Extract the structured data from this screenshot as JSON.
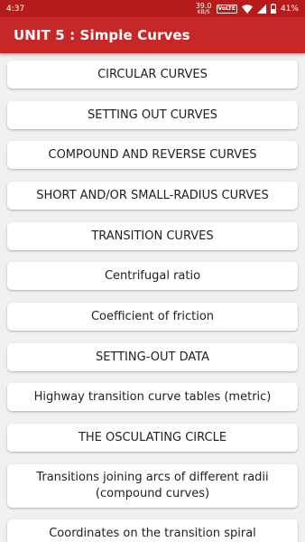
{
  "status_bar": {
    "time": "4:37",
    "net_speed": "39.0",
    "net_unit": "KB/S",
    "volte": "VoLTE",
    "battery": "41%"
  },
  "app_bar": {
    "title": "UNIT 5 : Simple Curves"
  },
  "topics": [
    "CIRCULAR CURVES",
    "SETTING OUT CURVES",
    "COMPOUND AND REVERSE CURVES",
    "SHORT AND/OR SMALL-RADIUS CURVES",
    "TRANSITION CURVES",
    "Centrifugal ratio",
    "Coefficient of friction",
    "SETTING-OUT DATA",
    "Highway transition curve tables (metric)",
    "THE OSCULATING CIRCLE",
    "Transitions joining arcs of different radii (compound curves)",
    "Coordinates on the transition spiral"
  ]
}
